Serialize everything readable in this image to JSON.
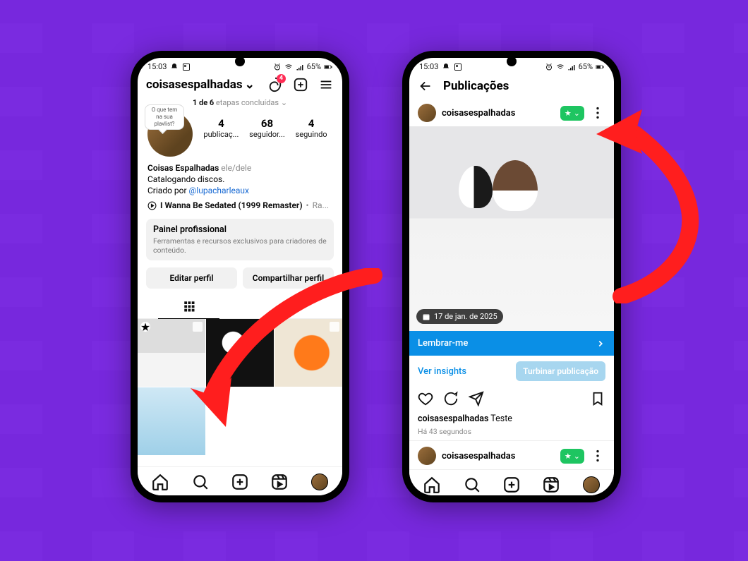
{
  "status": {
    "time": "15:03",
    "battery": "65%"
  },
  "left": {
    "username": "coisasespalhadas",
    "threads_badge": "4",
    "progress_pre": "1 de 6",
    "progress_post": "etapas concluídas",
    "bubble": "O que tem na sua playlist?",
    "stats": [
      {
        "n": "4",
        "l": "publicaç..."
      },
      {
        "n": "68",
        "l": "seguidor..."
      },
      {
        "n": "4",
        "l": "seguindo"
      }
    ],
    "bio_name": "Coisas Espalhadas",
    "bio_pron": "ele/dele",
    "bio_line": "Catalogando discos.",
    "bio_creator_pre": "Criado por ",
    "bio_creator_link": "@lupacharleaux",
    "song": "I Wanna Be Sedated (1999 Remaster)",
    "song_tail": "Ra...",
    "panel_title": "Painel profissional",
    "panel_sub": "Ferramentas e recursos exclusivos para criadores de conteúdo.",
    "btn_edit": "Editar perfil",
    "btn_share": "Compartilhar perfil"
  },
  "right": {
    "title": "Publicações",
    "username": "coisasespalhadas",
    "date": "17 de jan. de 2025",
    "remind": "Lembrar-me",
    "insights": "Ver insights",
    "boost": "Turbinar publicação",
    "caption_user": "coisasespalhadas",
    "caption_text": "Teste",
    "time": "Há 43 segundos"
  }
}
